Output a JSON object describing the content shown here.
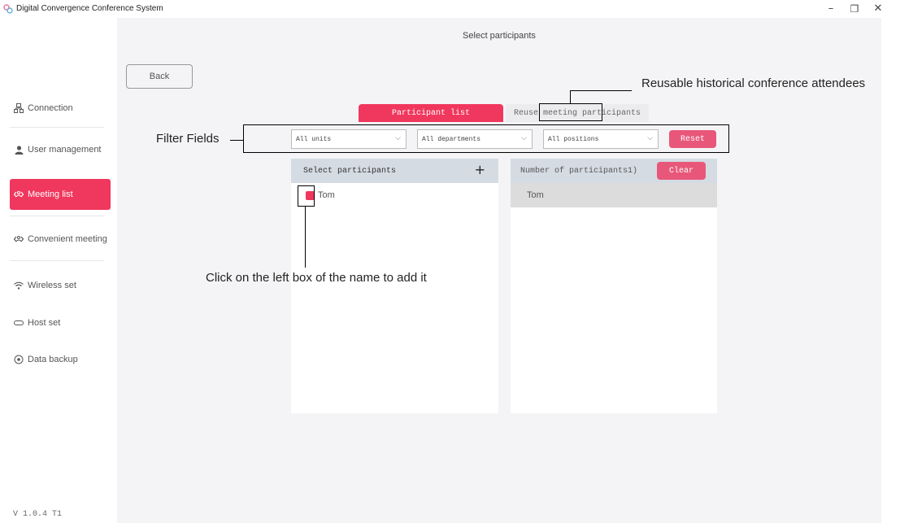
{
  "window": {
    "title": "Digital Convergence Conference System",
    "controls": {
      "minimize": "–",
      "maximize": "❐",
      "close": "✕"
    }
  },
  "sidebar": {
    "items": [
      {
        "label": "Connection",
        "icon": "connection-icon"
      },
      {
        "label": "User management",
        "icon": "user-icon"
      },
      {
        "label": "Meeting list",
        "icon": "meeting-icon",
        "active": true
      },
      {
        "label": "Convenient meeting",
        "icon": "meeting-icon"
      },
      {
        "label": "Wireless set",
        "icon": "wifi-icon"
      },
      {
        "label": "Host set",
        "icon": "host-icon"
      },
      {
        "label": "Data backup",
        "icon": "backup-icon"
      }
    ],
    "version": "V 1.0.4 T1"
  },
  "main": {
    "page_title": "Select participants",
    "back_label": "Back",
    "tabs": [
      {
        "label": "Participant list",
        "active": true
      },
      {
        "label": "Reuse meeting participants",
        "active": false
      }
    ],
    "filters": {
      "units": "All units",
      "departments": "All departments",
      "positions": "All positions",
      "reset_label": "Reset"
    },
    "left_panel": {
      "title": "Select participants",
      "add_label": "+",
      "rows": [
        "Tom"
      ]
    },
    "right_panel": {
      "title": "Number of participants1)",
      "clear_label": "Clear",
      "rows": [
        "Tom"
      ]
    }
  },
  "annotations": {
    "reuse_note": "Reusable historical conference attendees",
    "filter_note": "Filter Fields",
    "click_note": "Click on the left box of the name to add it"
  },
  "colors": {
    "accent": "#f0375d",
    "button_pink": "#e8577a",
    "panel_header": "#d5dbe3",
    "main_bg": "#f4f4f6"
  }
}
